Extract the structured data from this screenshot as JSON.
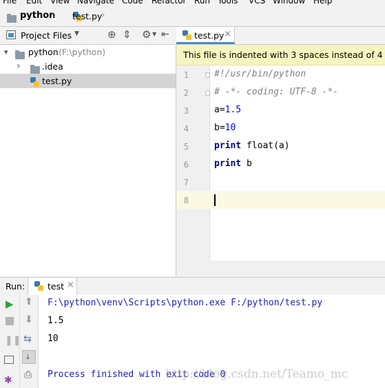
{
  "menu": [
    "File",
    "Edit",
    "View",
    "Navigate",
    "Code",
    "Refactor",
    "Run",
    "Tools",
    "VCS",
    "Window",
    "Help"
  ],
  "breadcrumb": {
    "project": "python",
    "file": "test.py"
  },
  "project_panel": {
    "title": "Project Files",
    "root": {
      "name": "python",
      "path": "(F:\\python)"
    },
    "items": [
      {
        "name": ".idea",
        "type": "folder"
      },
      {
        "name": "test.py",
        "type": "python-file"
      }
    ]
  },
  "editor": {
    "tab": "test.py",
    "tab_close": "×",
    "notice": "This file is indented with 3 spaces instead of 4",
    "line_numbers": [
      "1",
      "2",
      "3",
      "4",
      "5",
      "6",
      "7",
      "8"
    ],
    "lines": [
      {
        "tokens": [
          {
            "t": "#!/usr/bin/python",
            "c": "cmt"
          }
        ]
      },
      {
        "tokens": [
          {
            "t": "# -*- coding: UTF-8 -*-",
            "c": "cmt"
          }
        ]
      },
      {
        "tokens": [
          {
            "t": "a=",
            "c": ""
          },
          {
            "t": "1.5",
            "c": "num"
          }
        ]
      },
      {
        "tokens": [
          {
            "t": "b=",
            "c": ""
          },
          {
            "t": "10",
            "c": "num"
          }
        ]
      },
      {
        "tokens": [
          {
            "t": "print",
            "c": "kw"
          },
          {
            "t": " float(a)",
            "c": ""
          }
        ]
      },
      {
        "tokens": [
          {
            "t": "print",
            "c": "kw"
          },
          {
            "t": " b",
            "c": ""
          }
        ]
      },
      {
        "tokens": []
      },
      {
        "tokens": []
      }
    ]
  },
  "run_panel": {
    "label": "Run:",
    "tab": "test",
    "tab_close": "×",
    "output": [
      "F:\\python\\venv\\Scripts\\python.exe F:/python/test.py",
      "1.5",
      "10",
      "",
      "Process finished with exit code 0"
    ]
  },
  "watermark": "http://blog.csdn.net/Teamo_mc",
  "colors": {
    "run_green": "#2fa33a",
    "notice_bg": "#f5f5c0",
    "tab_underline": "#4a8bd0",
    "keyword": "#000080",
    "number": "#0000ff",
    "comment": "#808080",
    "console_text": "#2020b0"
  }
}
